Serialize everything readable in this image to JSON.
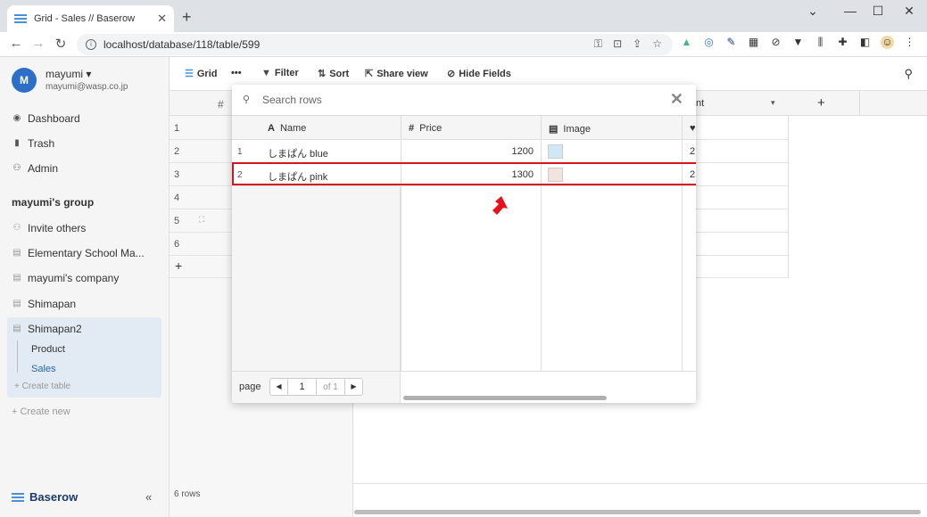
{
  "browser": {
    "tab_title": "Grid - Sales // Baserow",
    "tab_close": "✕",
    "new_tab": "+",
    "url": "localhost/database/118/table/599"
  },
  "user": {
    "initial": "M",
    "name": "mayumi ▾",
    "email": "mayumi@wasp.co.jp"
  },
  "sidebar": {
    "items": [
      {
        "label": "Dashboard",
        "icon": "dashboard-icon"
      },
      {
        "label": "Trash",
        "icon": "trash-icon"
      },
      {
        "label": "Admin",
        "icon": "admin-icon"
      }
    ],
    "group_title": "mayumi's group",
    "group_items": [
      {
        "label": "Invite others",
        "icon": "people-icon"
      },
      {
        "label": "Elementary School Ma...",
        "icon": "database-icon"
      },
      {
        "label": "mayumi's company",
        "icon": "database-icon"
      },
      {
        "label": "Shimapan",
        "icon": "database-icon"
      },
      {
        "label": "Shimapan2",
        "icon": "database-icon"
      }
    ],
    "tables": [
      "Product",
      "Sales"
    ],
    "create_table": "+ Create table",
    "create_new": "+ Create new",
    "brand": "Baserow",
    "collapse": "«"
  },
  "toolbar": {
    "grid": "Grid",
    "more": "•••",
    "filter": "Filter",
    "sort": "Sort",
    "share": "Share view",
    "hide": "Hide Fields"
  },
  "grid": {
    "hash_header": "#",
    "row_numbers": [
      "1",
      "2",
      "3",
      "4",
      "5",
      "6"
    ],
    "add_row": "+",
    "right_header": "nt",
    "right_header_caret": "▾",
    "add_field": "+",
    "row_count": "6 rows"
  },
  "modal": {
    "search_placeholder": "Search rows",
    "close": "✕",
    "columns": [
      {
        "icon": "A",
        "label": "Name"
      },
      {
        "icon": "#",
        "label": "Price"
      },
      {
        "icon": "▤",
        "label": "Image"
      },
      {
        "icon": "♥",
        "label": ""
      }
    ],
    "rows": [
      {
        "num": "1",
        "name": "しまぱん blue",
        "price": "1200",
        "image": "blue",
        "extra": "2"
      },
      {
        "num": "2",
        "name": "しまぱん pink",
        "price": "1300",
        "image": "pink",
        "extra": "2"
      }
    ],
    "page_label": "page",
    "page_number": "1",
    "page_of": "of 1",
    "prev": "◀",
    "next": "▶"
  },
  "colors": {
    "highlight": "#d8141d",
    "arrow": "#e8111a",
    "avatar": "#2d6ec8",
    "active_db": "#e2ebf4"
  }
}
